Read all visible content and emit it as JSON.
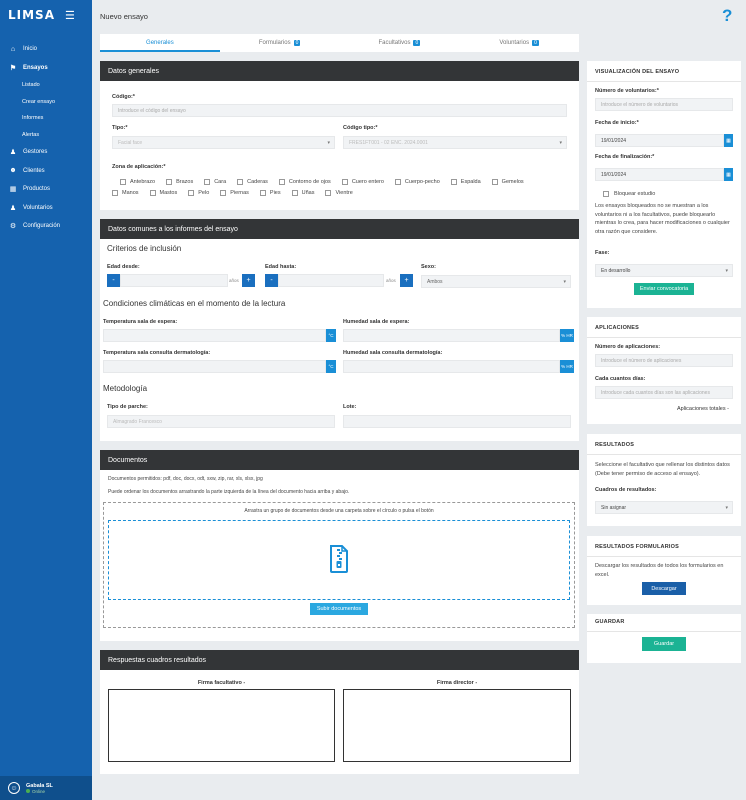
{
  "app": {
    "logo": "LIMSA",
    "page_title": "Nuevo ensayo",
    "help": "?"
  },
  "sidebar": {
    "items": [
      {
        "label": "Inicio",
        "icon": "⌂"
      },
      {
        "label": "Ensayos",
        "icon": "⚑"
      },
      {
        "label": "Gestores",
        "icon": "♟"
      },
      {
        "label": "Clientes",
        "icon": "☻"
      },
      {
        "label": "Productos",
        "icon": "▦"
      },
      {
        "label": "Voluntarios",
        "icon": "♟"
      },
      {
        "label": "Configuración",
        "icon": "⚙"
      }
    ],
    "subitems": [
      "Listado",
      "Crear ensayo",
      "Informes",
      "Alertas"
    ],
    "user": {
      "name": "Gabala SL",
      "status": "Online"
    }
  },
  "tabs": [
    {
      "label": "Generales",
      "count": ""
    },
    {
      "label": "Formularios",
      "count": "0"
    },
    {
      "label": "Facultativos",
      "count": "0"
    },
    {
      "label": "Voluntarios",
      "count": "0"
    }
  ],
  "datos_generales": {
    "title": "Datos generales",
    "codigo_label": "Código:*",
    "codigo_placeholder": "Introduce el código del ensayo",
    "tipo_label": "Tipo:*",
    "tipo_value": "Facial face",
    "codigo_tipo_label": "Código tipo:*",
    "codigo_tipo_value": "FRES1FT001 - 02 ENC. 2024.0001",
    "zona_label": "Zona de aplicación:*",
    "zonas_row1": [
      "Antebrazo",
      "Brazos",
      "Cara",
      "Caderas",
      "Contorno de ojos",
      "Cuero entero",
      "Cuerpo-pecho",
      "Espalda",
      "Gemelos"
    ],
    "zonas_row2": [
      "Manos",
      "Mastos",
      "Pelo",
      "Piernas",
      "Pies",
      "Uñas",
      "Vientre"
    ]
  },
  "datos_comunes": {
    "title": "Datos comunes a los informes del ensayo",
    "criterios_title": "Criterios de inclusión",
    "edad_desde_label": "Edad desde:",
    "edad_hasta_label": "Edad hasta:",
    "anos_unit": "años",
    "sexo_label": "Sexo:",
    "sexo_value": "Ambos",
    "condiciones_title": "Condiciones climáticas en el momento de la lectura",
    "temp_espera_label": "Temperatura sala de espera:",
    "hum_espera_label": "Humedad sala de espera:",
    "temp_consulta_label": "Temperatura sala consulta dermatología:",
    "hum_consulta_label": "Humedad sala consulta dermatología:",
    "celsius": "°C",
    "hr": "% HR",
    "metodologia_title": "Metodología",
    "parche_label": "Tipo de parche:",
    "parche_value": "Almagrado Francesco",
    "lote_label": "Lote:"
  },
  "documentos": {
    "title": "Documentos",
    "permitidos": "Documentos permitidos: pdf, doc, docx, odt, sxw, zip, rar, xls, xlsx, jpg",
    "ordenar": "Puede ordenar los documentos arrastrando la parte izquierda de la línea del documento hacia arriba y abajo.",
    "arrastra": "Arrastra un grupo de documentos desde una carpeta sobre el círculo o pulsa el botón",
    "subir": "Subir documentos"
  },
  "respuestas": {
    "title": "Respuestas cuadros resultados",
    "firma_facultativo": "Firma facultativo -",
    "firma_director": "Firma director -"
  },
  "visualizacion": {
    "title": "VISUALIZACIÓN DEL ENSAYO",
    "num_vol_label": "Número de voluntarios:*",
    "num_vol_placeholder": "Introduce el número de voluntarios",
    "inicio_label": "Fecha de inicio:*",
    "inicio_value": "19/01/2024",
    "fin_label": "Fecha de finalización:*",
    "fin_value": "19/01/2024",
    "bloquear_label": "Bloquear estudio",
    "bloqueo_info": "Los ensayos bloqueados no se muestran a los voluntarios ni a los facultativos, puede bloquearlo mientras lo crea, para hacer modificaciones o cualquier otra razón que considere.",
    "fase_label": "Fase:",
    "fase_value": "En desarrollo",
    "enviar": "Enviar convocatoria"
  },
  "aplicaciones": {
    "title": "APLICACIONES",
    "num_label": "Número de aplicaciones:",
    "num_placeholder": "Introduce el número de aplicaciones",
    "cada_label": "Cada cuantos días:",
    "cada_placeholder": "Introduce cada cuantos días son las aplicaciones",
    "totales": "Aplicaciones totales -"
  },
  "resultados": {
    "title": "RESULTADOS",
    "info": "Seleccione el facultativo que rellenar los distintos datos (Debe tener permiso de acceso al ensayo).",
    "cuadros_label": "Cuadros de resultados:",
    "cuadros_value": "Sin asignar"
  },
  "resultados_formularios": {
    "title": "RESULTADOS FORMULARIOS",
    "info": "Descargar los resultados de todos los formularios en excel.",
    "descargar": "Descargar"
  },
  "guardar": {
    "title": "GUARDAR",
    "button": "Guardar"
  }
}
